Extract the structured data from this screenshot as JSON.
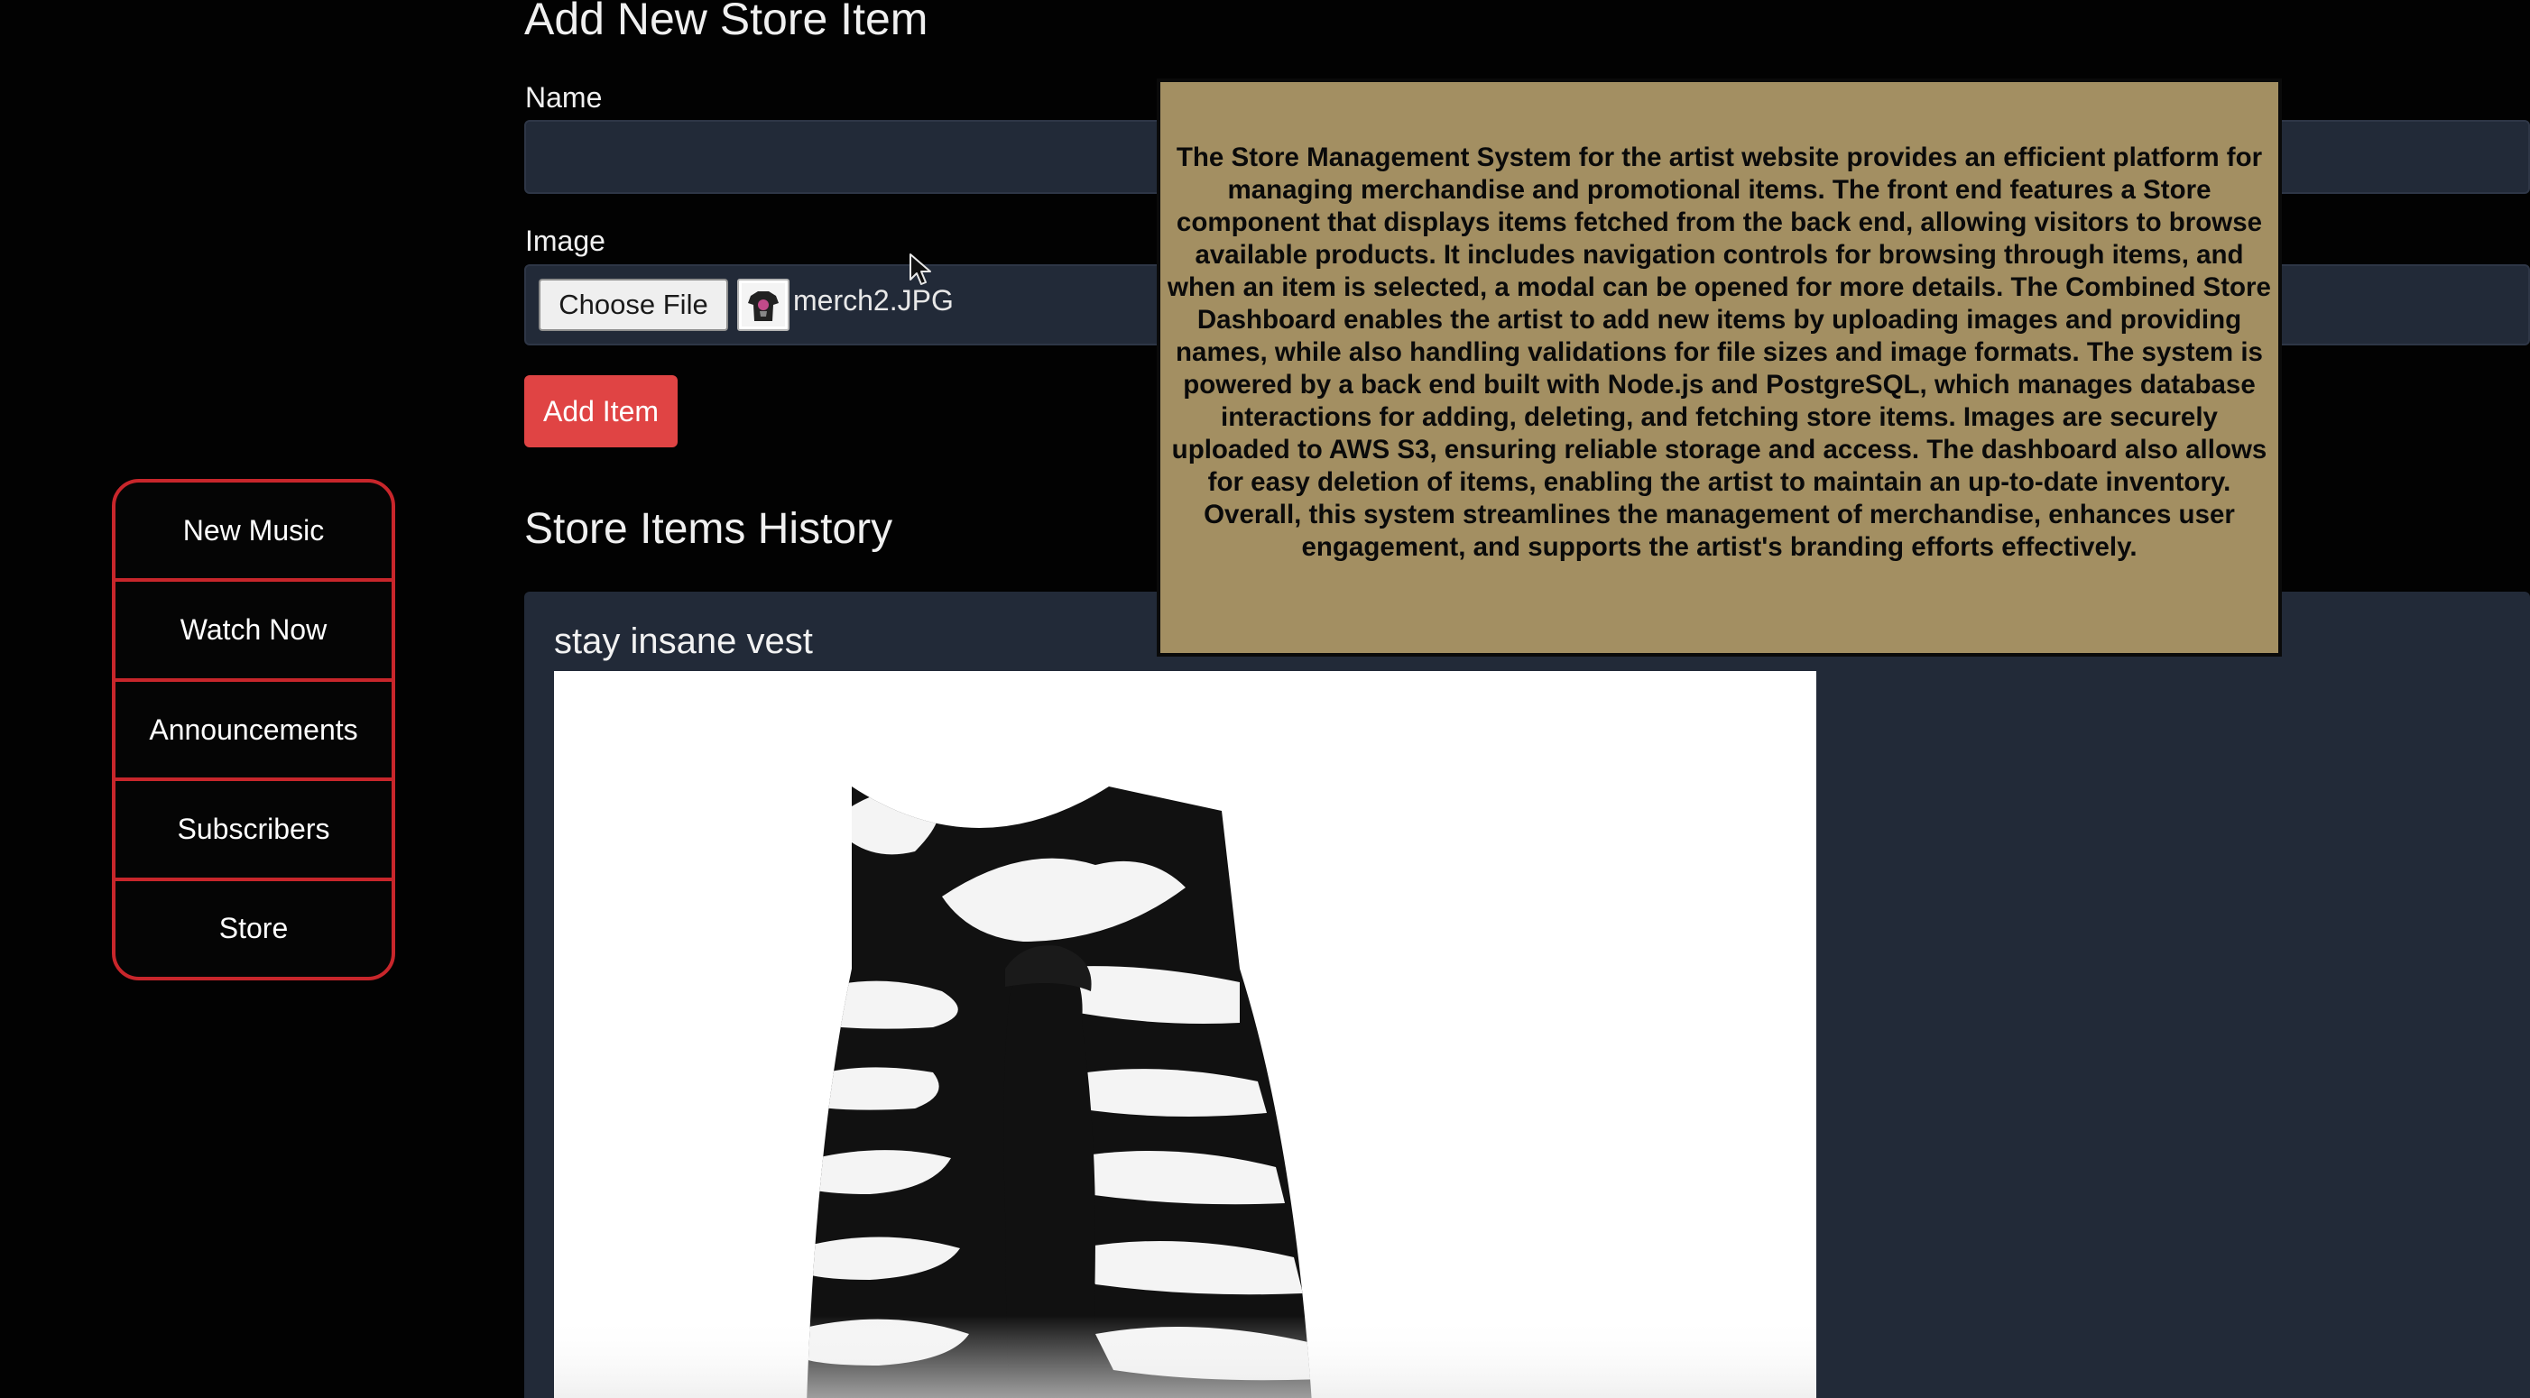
{
  "form": {
    "title": "Add New Store Item",
    "name_label": "Name",
    "name_value": "",
    "image_label": "Image",
    "choose_file_label": "Choose File",
    "file_name": "merch2.JPG",
    "add_button_label": "Add Item"
  },
  "sidebar": {
    "items": [
      {
        "label": "New Music"
      },
      {
        "label": "Watch Now"
      },
      {
        "label": "Announcements"
      },
      {
        "label": "Subscribers"
      },
      {
        "label": "Store"
      }
    ]
  },
  "history": {
    "title": "Store Items History",
    "items": [
      {
        "name": "stay insane vest"
      }
    ]
  },
  "overlay": {
    "text": "The Store Management System for the artist website provides an efficient platform for managing merchandise and promotional items. The front end features a Store component that displays items fetched from the back end, allowing visitors to browse available products. It includes navigation controls for browsing through items, and when an item is selected, a modal can be opened for more details. The Combined Store Dashboard enables the artist to add new items by uploading images and providing names, while also handling validations for file sizes and image formats. The system is powered by a back end built with Node.js and PostgreSQL, which manages database interactions for adding, deleting, and fetching store items. Images are securely uploaded to AWS S3, ensuring reliable storage and access. The dashboard also allows for easy deletion of items, enabling the artist to maintain an up-to-date inventory. Overall, this system streamlines the management of merchandise, enhances user engagement, and supports the artist's branding efforts effectively."
  },
  "icons": {
    "cursor": "mouse-pointer-icon",
    "thumbnail": "shirt-thumbnail-icon"
  },
  "colors": {
    "background": "#020202",
    "panel": "#222a38",
    "accent_red": "#c8262b",
    "add_button": "#e04444",
    "overlay_bg": "#a38f62"
  }
}
